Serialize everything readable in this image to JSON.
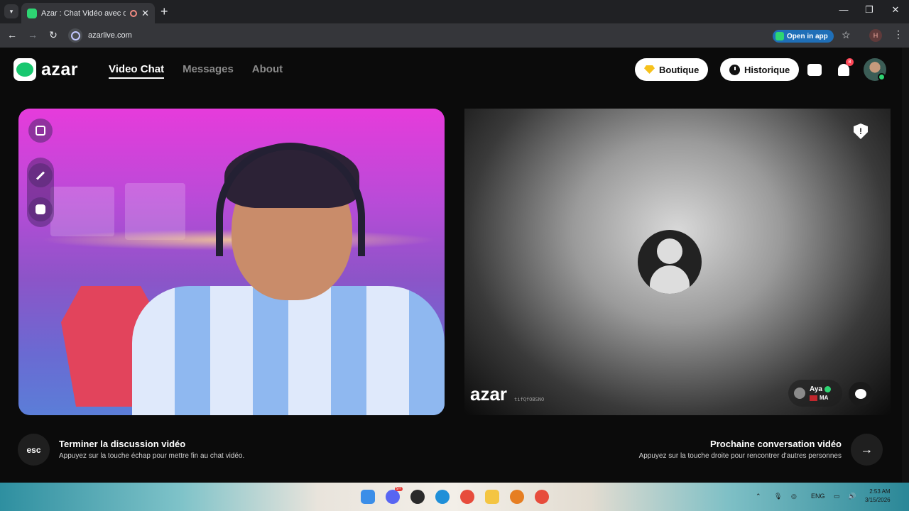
{
  "browser": {
    "tab_title": "Azar : Chat Vidéo avec de n",
    "url": "azarlive.com",
    "open_in_app": "Open in app",
    "profile_initial": "H"
  },
  "header": {
    "logo_text": "azar",
    "nav": [
      "Video Chat",
      "Messages",
      "About"
    ],
    "boutique_label": "Boutique",
    "historique_label": "Historique",
    "notification_count": "8"
  },
  "remote": {
    "watermark": "azar",
    "session_id": "tifQfOBSNO",
    "user_name": "Aya",
    "user_country": "MA"
  },
  "actions": {
    "esc_key": "esc",
    "end_title": "Terminer la discussion vidéo",
    "end_subtitle": "Appuyez sur la touche échap pour mettre fin au chat vidéo.",
    "next_title": "Prochaine conversation vidéo",
    "next_subtitle": "Appuyez sur la touche droite pour rencontrer d'autres personnes"
  },
  "taskbar": {
    "language": "ENG",
    "time": "2:53 AM",
    "date": "3/15/2026",
    "discord_badge": "9+"
  },
  "colors": {
    "brand_green": "#18c76f",
    "notification_red": "#ff4757",
    "page_bg": "#0b0b0b"
  }
}
